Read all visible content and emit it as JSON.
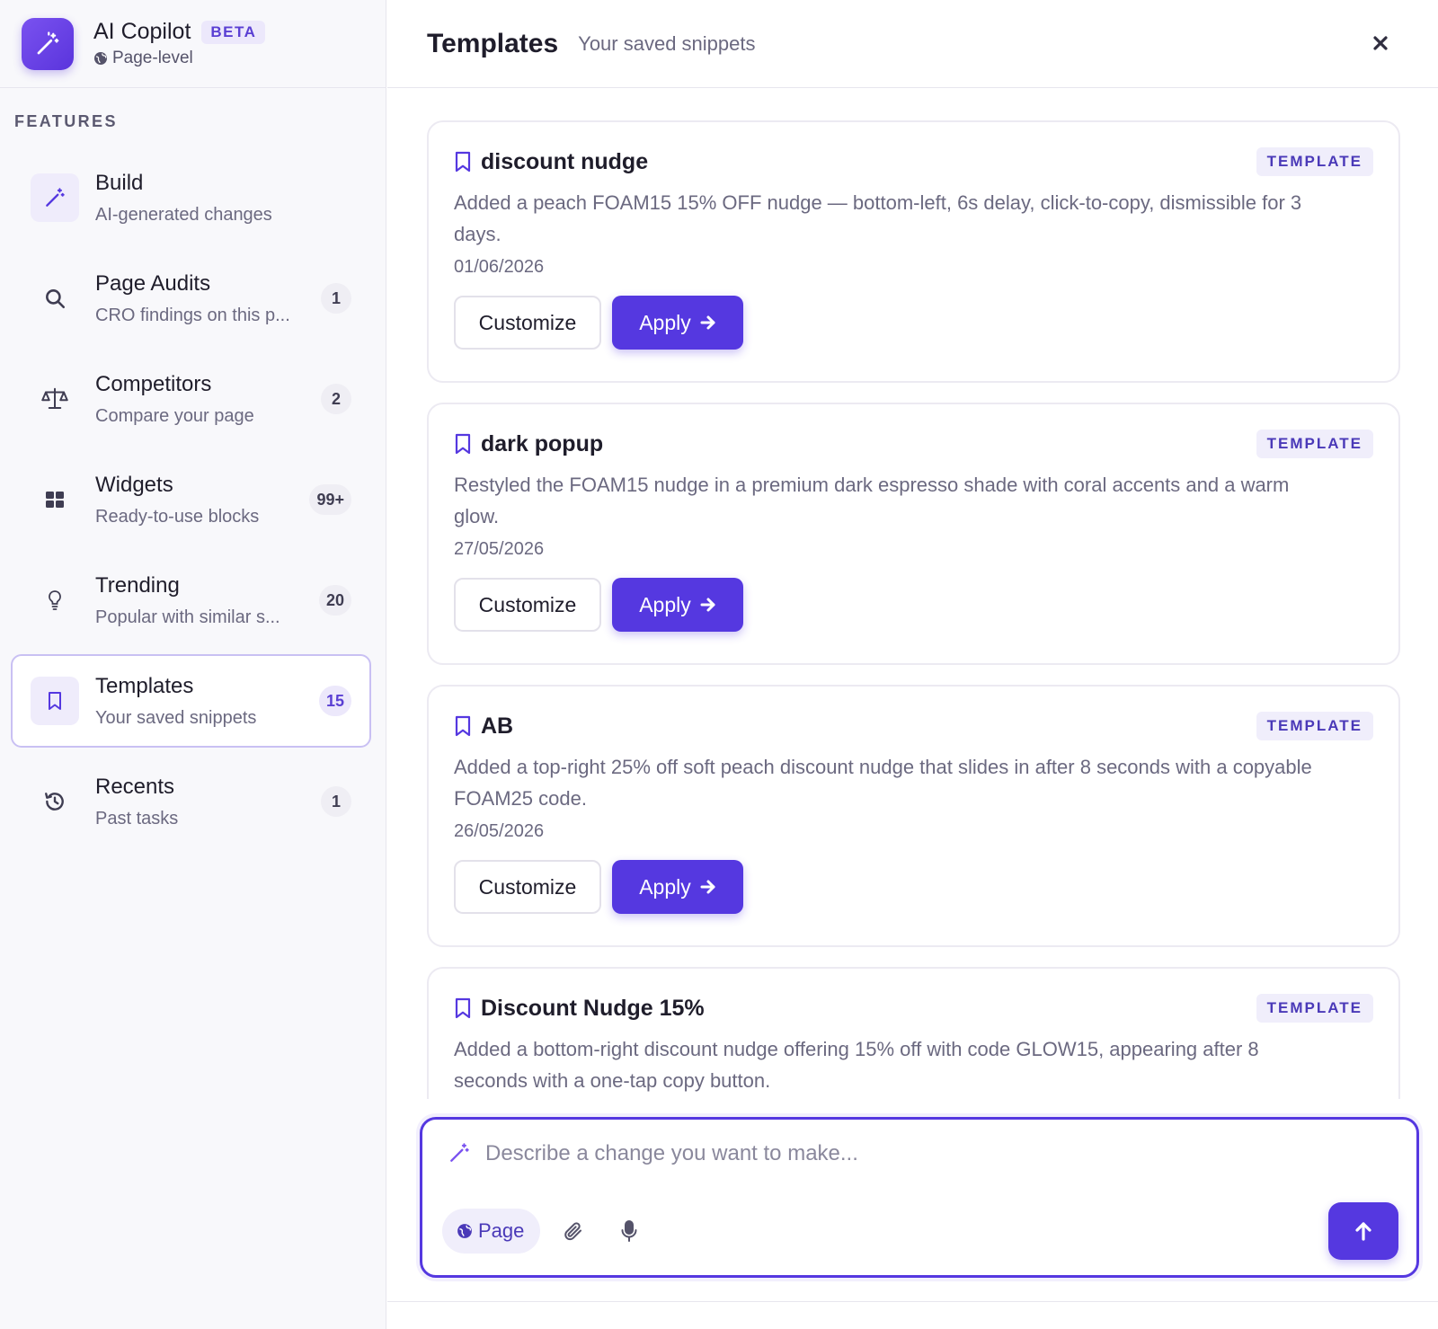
{
  "app": {
    "title": "AI Copilot",
    "badge": "BETA",
    "scope": "Page-level"
  },
  "sidebar": {
    "section_label": "FEATURES",
    "items": [
      {
        "title": "Build",
        "subtitle": "AI-generated changes",
        "badge": "",
        "icon": "magic-wand-icon"
      },
      {
        "title": "Page Audits",
        "subtitle": "CRO findings on this p...",
        "badge": "1",
        "icon": "search-icon"
      },
      {
        "title": "Competitors",
        "subtitle": "Compare your page",
        "badge": "2",
        "icon": "scale-icon"
      },
      {
        "title": "Widgets",
        "subtitle": "Ready-to-use blocks",
        "badge": "99+",
        "icon": "grid-icon"
      },
      {
        "title": "Trending",
        "subtitle": "Popular with similar s...",
        "badge": "20",
        "icon": "lightbulb-icon"
      },
      {
        "title": "Templates",
        "subtitle": "Your saved snippets",
        "badge": "15",
        "icon": "bookmark-icon",
        "active": true
      },
      {
        "title": "Recents",
        "subtitle": "Past tasks",
        "badge": "1",
        "icon": "history-icon"
      }
    ]
  },
  "main": {
    "title": "Templates",
    "subtitle": "Your saved snippets",
    "cards": [
      {
        "title": "discount nudge",
        "tag": "TEMPLATE",
        "description": "Added a peach FOAM15 15% OFF nudge — bottom-left, 6s delay, click-to-copy, dismissible for 3 days.",
        "date": "01/06/2026",
        "customize_label": "Customize",
        "apply_label": "Apply"
      },
      {
        "title": "dark popup",
        "tag": "TEMPLATE",
        "description": "Restyled the FOAM15 nudge in a premium dark espresso shade with coral accents and a warm glow.",
        "date": "27/05/2026",
        "customize_label": "Customize",
        "apply_label": "Apply"
      },
      {
        "title": "AB",
        "tag": "TEMPLATE",
        "description": "Added a top-right 25% off soft peach discount nudge that slides in after 8 seconds with a copyable FOAM25 code.",
        "date": "26/05/2026",
        "customize_label": "Customize",
        "apply_label": "Apply"
      },
      {
        "title": "Discount Nudge 15%",
        "tag": "TEMPLATE",
        "description": "Added a bottom-right discount nudge offering 15% off with code GLOW15, appearing after 8 seconds with a one-tap copy button.",
        "date": "",
        "customize_label": "",
        "apply_label": ""
      }
    ]
  },
  "composer": {
    "placeholder": "Describe a change you want to make...",
    "value": "",
    "scope_chip": "Page"
  },
  "colors": {
    "accent": "#5538e0",
    "accent_soft": "#ece8fb",
    "sidebar_bg": "#f8f8fb",
    "text_primary": "#1f1d2b",
    "text_muted": "#6b6980"
  }
}
